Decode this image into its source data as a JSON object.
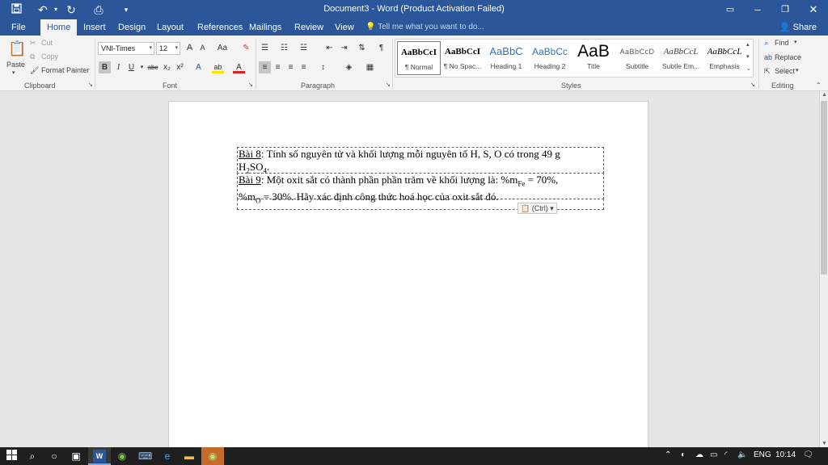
{
  "titlebar": {
    "title": "Document3 - Word (Product Activation Failed)",
    "icons": [
      "save-icon",
      "undo-icon",
      "redo-icon",
      "print-preview-icon",
      "customize-qat-icon"
    ],
    "buttons": [
      "ribbon-display-options",
      "minimize",
      "restore",
      "close"
    ]
  },
  "tabs": [
    "File",
    "Home",
    "Insert",
    "Design",
    "Layout",
    "References",
    "Mailings",
    "Review",
    "View"
  ],
  "tellme": "Tell me what you want to do...",
  "share": "Share",
  "clipboard": {
    "paste": "Paste",
    "cut": "Cut",
    "copy": "Copy",
    "format_painter": "Format Painter",
    "label": "Clipboard"
  },
  "font": {
    "name": "VNI-Times",
    "size": "12",
    "bold": "B",
    "italic": "I",
    "underline": "U",
    "strike": "abc",
    "subscript": "x₂",
    "superscript": "x²",
    "case": "Aa",
    "grow": "A",
    "shrink": "A",
    "label": "Font"
  },
  "paragraph": {
    "label": "Paragraph",
    "pilcrow": "¶"
  },
  "styles": {
    "label": "Styles",
    "items": [
      {
        "sample": "AaBbCcI",
        "name": "¶ Normal"
      },
      {
        "sample": "AaBbCcI",
        "name": "¶ No Spac..."
      },
      {
        "sample": "AaBbC",
        "name": "Heading 1"
      },
      {
        "sample": "AaBbCc",
        "name": "Heading 2"
      },
      {
        "sample": "AaB",
        "name": "Title"
      },
      {
        "sample": "AaBbCcD",
        "name": "Subtitle"
      },
      {
        "sample": "AaBbCcL",
        "name": "Subtle Em..."
      },
      {
        "sample": "AaBbCcL",
        "name": "Emphasis"
      }
    ]
  },
  "editing": {
    "find": "Find",
    "replace": "Replace",
    "select": "Select",
    "label": "Editing"
  },
  "document": {
    "row1": {
      "label": "Bài 8",
      "text": ": Tính số nguyên tử và khối lượng mỗi nguyên tố H, S, O có trong 49 g",
      "formula_a": "H",
      "formula_a_sub": "2",
      "formula_b": "SO",
      "formula_b_sub": "4",
      "end": "."
    },
    "row2": {
      "label": "Bài 9",
      "text": ": Một oxit sắt có thành phần phần trăm về khối lượng là: %m",
      "sub_fe": "Fe",
      "after_fe": " = 70%,",
      "line2_a": "%m",
      "sub_o": "O",
      "line2_b": " = 30%. Hãy xác định công thức hoá học của oxit sắt đó."
    },
    "paste_options": "(Ctrl)"
  },
  "taskbar": {
    "language": "ENG",
    "time": "10:14"
  },
  "colors": {
    "brand": "#2b579a",
    "ribbon": "#f3f3f3",
    "taskbar": "#1f1f1f"
  }
}
